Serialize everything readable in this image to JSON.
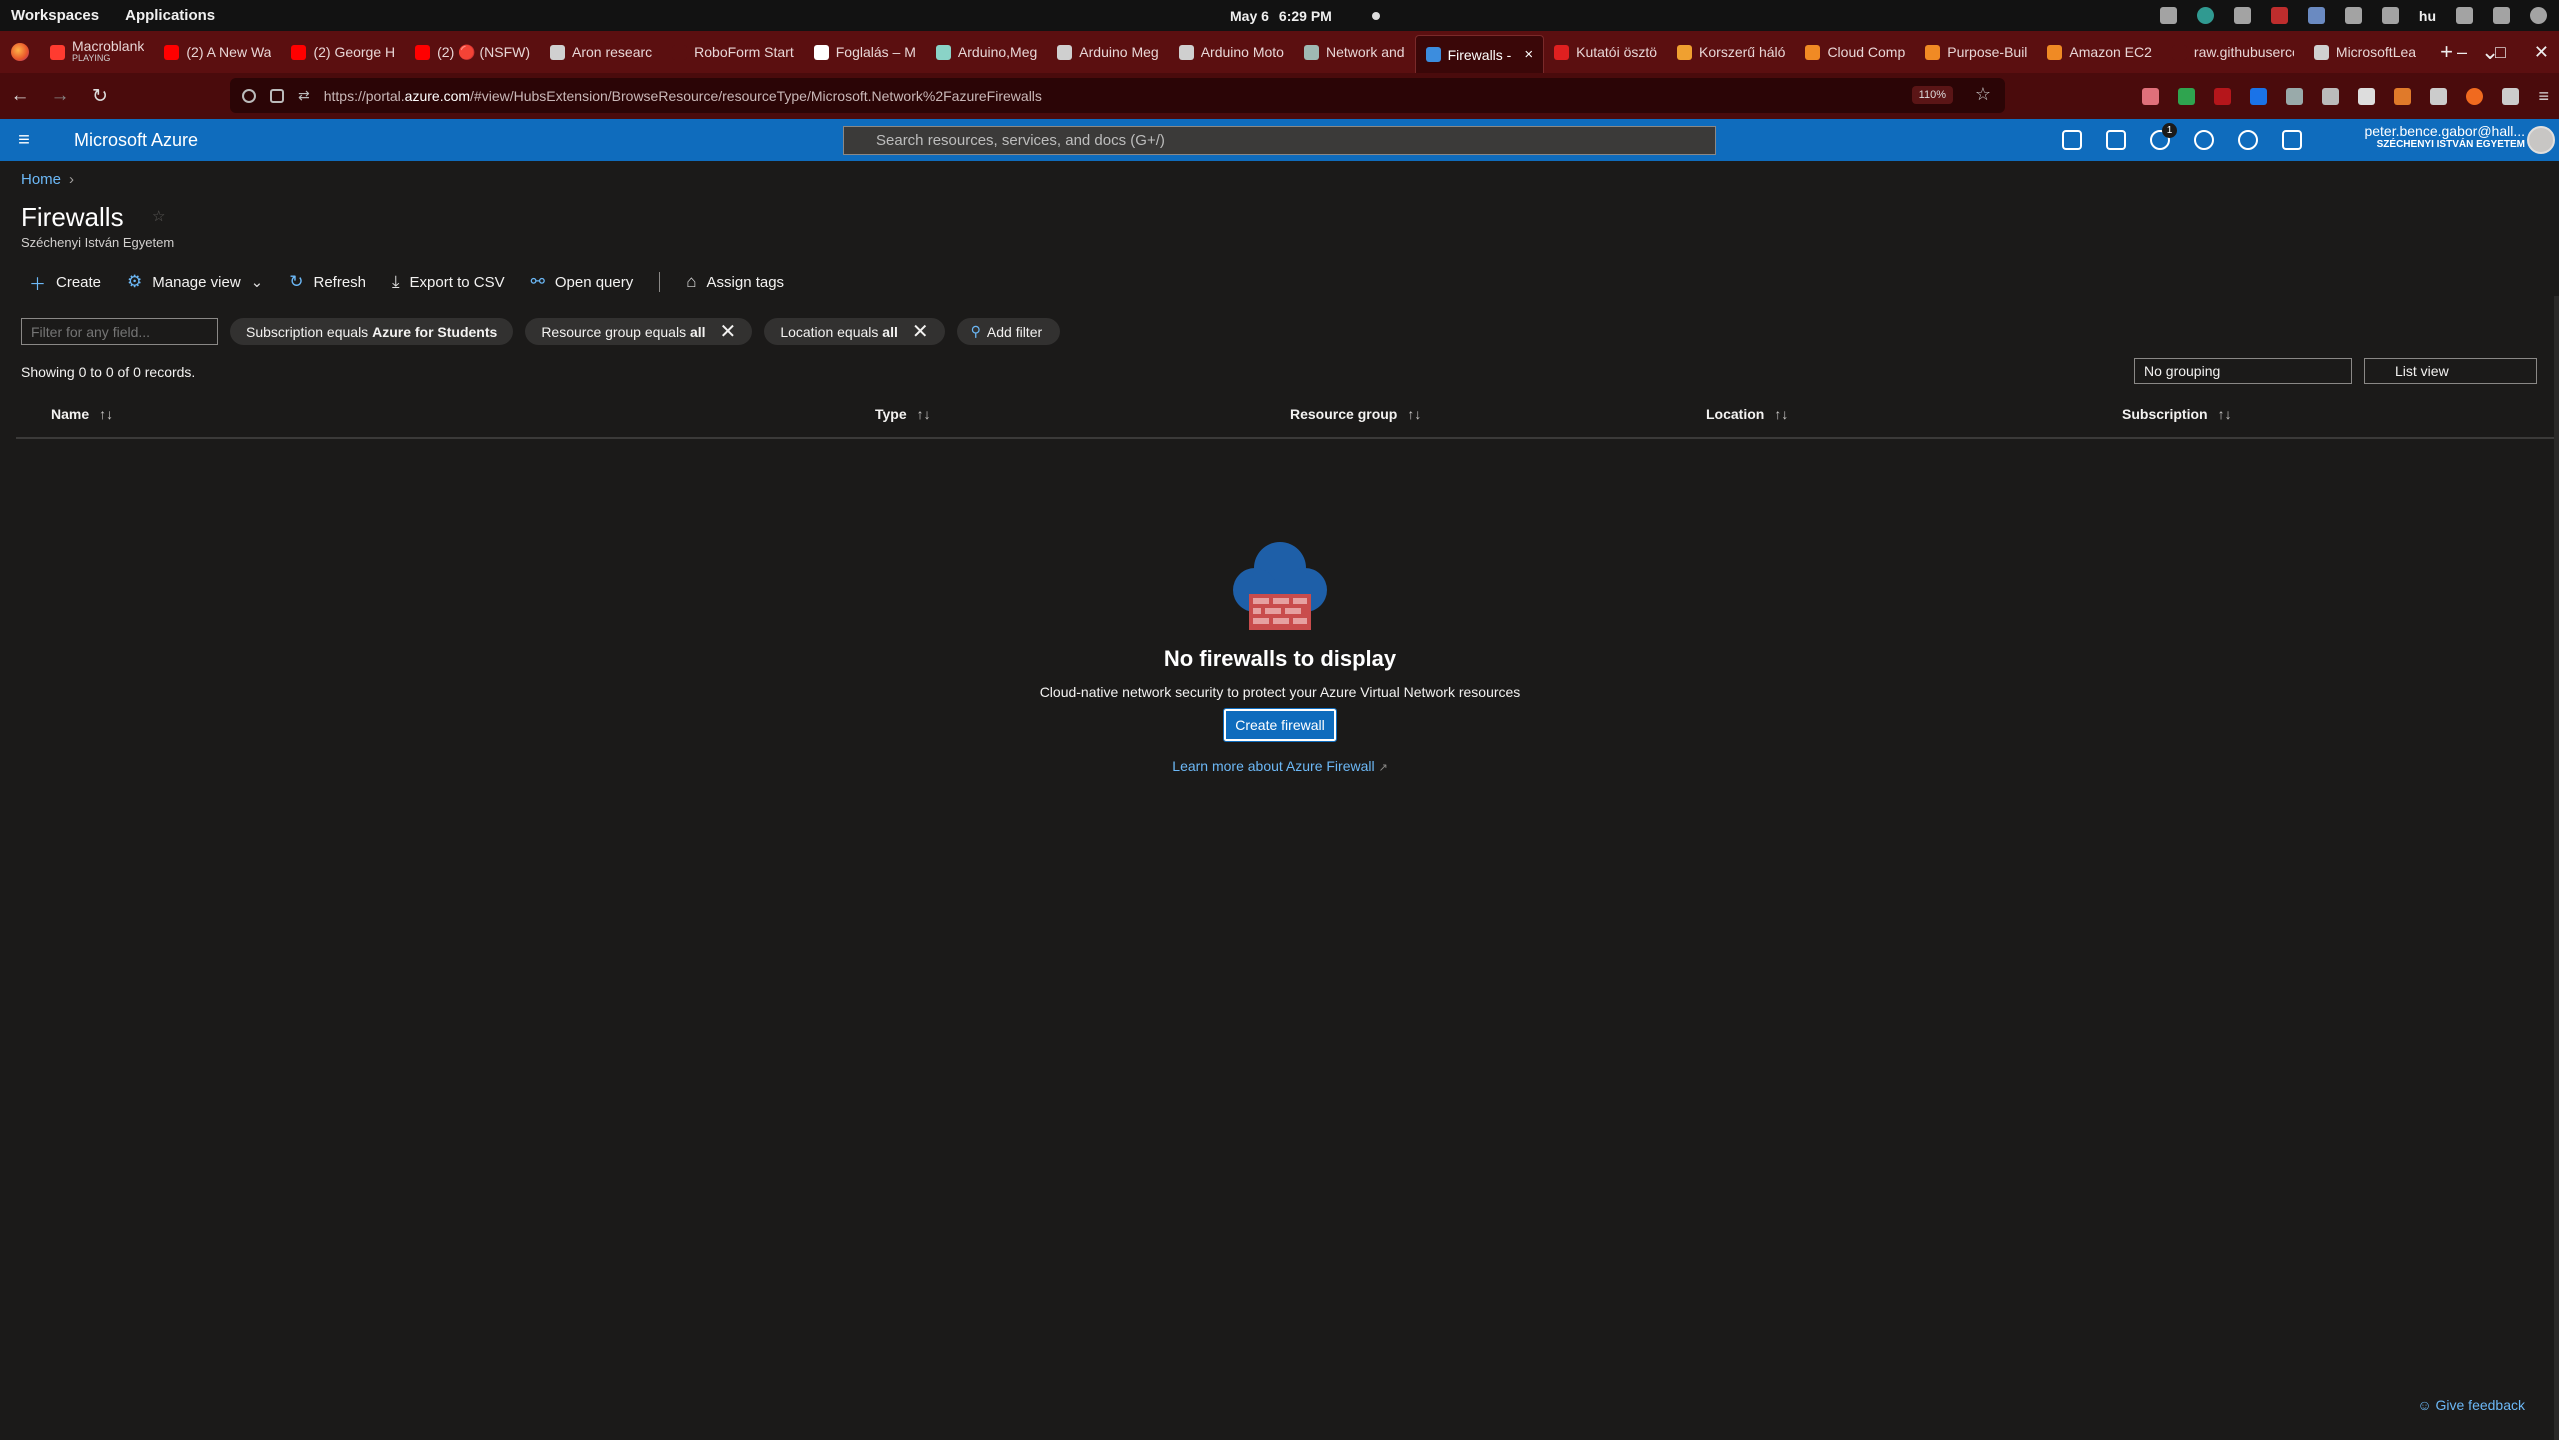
{
  "system": {
    "menus": [
      "Workspaces",
      "Applications"
    ],
    "date": "May 6",
    "time": "6:29 PM",
    "lang": "hu"
  },
  "tabs": [
    {
      "title": "Macroblank",
      "sub": "PLAYING",
      "color": "#ff3b30"
    },
    {
      "title": "(2) A New Wa",
      "color": "#ff0000"
    },
    {
      "title": "(2) George H",
      "color": "#ff0000"
    },
    {
      "title": "(2) 🔴 (NSFW)",
      "color": "#ff0000"
    },
    {
      "title": "Aron researc",
      "color": "#d0d0d0"
    },
    {
      "title": "RoboForm Start",
      "color": "#5b0f10"
    },
    {
      "title": "Foglalás – M",
      "color": "#ffffff"
    },
    {
      "title": "Arduino,Meg",
      "color": "#8ad3c7"
    },
    {
      "title": "Arduino Meg",
      "color": "#cfcfcf"
    },
    {
      "title": "Arduino Moto",
      "color": "#cfcfcf"
    },
    {
      "title": "Network and",
      "color": "#9fb9b3"
    },
    {
      "title": "Firewalls -",
      "color": "#3c8dde",
      "active": true
    },
    {
      "title": "Kutatói ösztö",
      "color": "#e02020"
    },
    {
      "title": "Korszerű háló",
      "color": "#f0a030"
    },
    {
      "title": "Cloud Comp",
      "color": "#f08a24"
    },
    {
      "title": "Purpose-Buil",
      "color": "#f08a24"
    },
    {
      "title": "Amazon EC2",
      "color": "#f08a24"
    },
    {
      "title": "raw.githubuserco",
      "color": "#5b0f10"
    },
    {
      "title": "MicrosoftLea",
      "color": "#d0d0d0"
    }
  ],
  "address": {
    "prefix": "https://portal.",
    "domain": "azure.com",
    "path": "/#view/HubsExtension/BrowseResource/resourceType/Microsoft.Network%2FazureFirewalls",
    "zoom": "110%"
  },
  "azure": {
    "brand": "Microsoft Azure",
    "search_placeholder": "Search resources, services, and docs (G+/)",
    "notifications": "1",
    "account_email": "peter.bence.gabor@hall...",
    "account_org": "SZÉCHENYI ISTVÁN EGYETEM"
  },
  "page": {
    "breadcrumb": "Home",
    "title": "Firewalls",
    "subtitle": "Széchenyi István Egyetem",
    "toolbar": {
      "create": "Create",
      "manage_view": "Manage view",
      "refresh": "Refresh",
      "export": "Export to CSV",
      "open_query": "Open query",
      "assign_tags": "Assign tags"
    },
    "filter_placeholder": "Filter for any field...",
    "filters": {
      "subscription_prefix": "Subscription equals ",
      "subscription_value": "Azure for Students",
      "rg_prefix": "Resource group equals ",
      "rg_value": "all",
      "loc_prefix": "Location equals ",
      "loc_value": "all",
      "add": "Add filter"
    },
    "records": "Showing 0 to 0 of 0 records.",
    "grouping": "No grouping",
    "view": "List view",
    "columns": [
      "Name",
      "Type",
      "Resource group",
      "Location",
      "Subscription"
    ],
    "empty": {
      "title": "No firewalls to display",
      "desc": "Cloud-native network security to protect your Azure Virtual Network resources",
      "button": "Create firewall",
      "link": "Learn more about Azure Firewall"
    },
    "feedback": "Give feedback"
  }
}
